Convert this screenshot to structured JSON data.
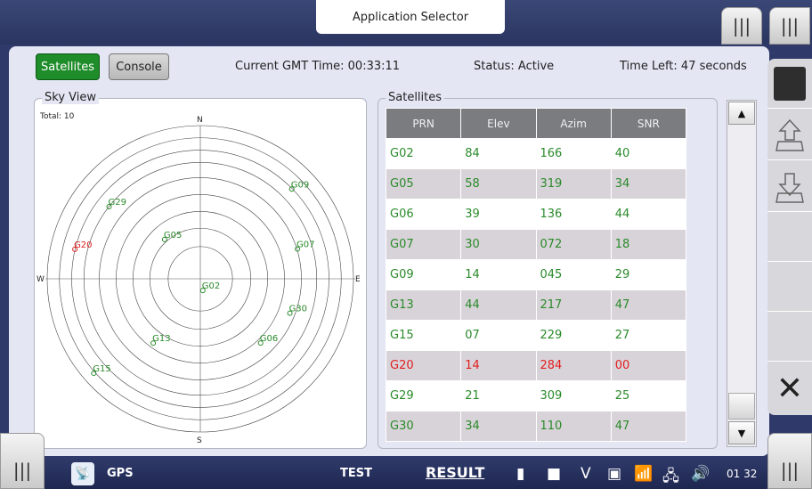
{
  "top": {
    "app_selector": "Application Selector",
    "tab_icon": "|||"
  },
  "header": {
    "satellites_btn": "Satellites",
    "console_btn": "Console",
    "gmt": "Current GMT Time: 00:33:11",
    "status": "Status: Active",
    "time_left": "Time Left: 47 seconds"
  },
  "sky": {
    "title": "Sky View",
    "total": "Total: 10",
    "north": "N",
    "south": "S",
    "east": "E",
    "west": "W",
    "sats": [
      {
        "id": "G02",
        "elev": 84,
        "azim": 166,
        "color": "#2a8a2a"
      },
      {
        "id": "G05",
        "elev": 58,
        "azim": 319,
        "color": "#2a8a2a"
      },
      {
        "id": "G06",
        "elev": 39,
        "azim": 136,
        "color": "#2a8a2a"
      },
      {
        "id": "G07",
        "elev": 30,
        "azim": 72,
        "color": "#2a8a2a"
      },
      {
        "id": "G09",
        "elev": 14,
        "azim": 45,
        "color": "#2a8a2a"
      },
      {
        "id": "G13",
        "elev": 44,
        "azim": 217,
        "color": "#2a8a2a"
      },
      {
        "id": "G15",
        "elev": 7,
        "azim": 229,
        "color": "#2a8a2a"
      },
      {
        "id": "G20",
        "elev": 14,
        "azim": 284,
        "color": "#e02020"
      },
      {
        "id": "G29",
        "elev": 21,
        "azim": 309,
        "color": "#2a8a2a"
      },
      {
        "id": "G30",
        "elev": 34,
        "azim": 110,
        "color": "#2a8a2a"
      }
    ]
  },
  "table": {
    "title": "Satellites",
    "headers": [
      "PRN",
      "Elev",
      "Azim",
      "SNR"
    ],
    "rows": [
      [
        "G02",
        "84",
        "166",
        "40"
      ],
      [
        "G05",
        "58",
        "319",
        "34"
      ],
      [
        "G06",
        "39",
        "136",
        "44"
      ],
      [
        "G07",
        "30",
        "072",
        "18"
      ],
      [
        "G09",
        "14",
        "045",
        "29"
      ],
      [
        "G13",
        "44",
        "217",
        "47"
      ],
      [
        "G15",
        "07",
        "229",
        "27"
      ],
      [
        "G20",
        "14",
        "284",
        "00"
      ],
      [
        "G29",
        "21",
        "309",
        "25"
      ],
      [
        "G30",
        "34",
        "110",
        "47"
      ]
    ],
    "warn_row": 7
  },
  "scrollbar": {
    "up": "▲",
    "down": "▼"
  },
  "bottom": {
    "gps": "GPS",
    "test": "TEST",
    "result": "RESULT",
    "v": "V",
    "clock": "01 32"
  },
  "colors": {
    "accent": "#1f8c2a",
    "bar": "#2f3a6a",
    "warn": "#e02020"
  }
}
